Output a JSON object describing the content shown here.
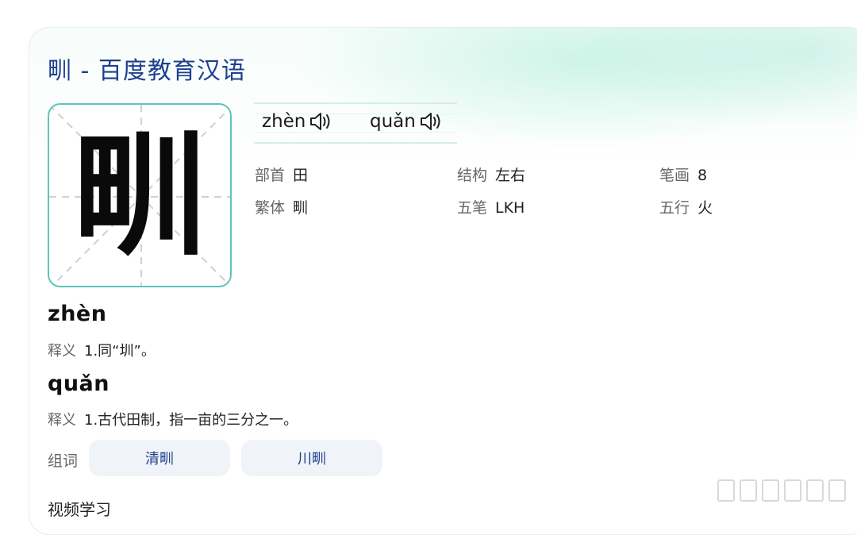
{
  "header": {
    "title": "甽 - 百度教育汉语"
  },
  "character": {
    "glyph": "甽"
  },
  "pronunciations": [
    {
      "pinyin": "zhèn",
      "icon": "speaker-icon"
    },
    {
      "pinyin": "quǎn",
      "icon": "speaker-icon"
    }
  ],
  "info": {
    "radical": {
      "label": "部首",
      "value": "田"
    },
    "structure": {
      "label": "结构",
      "value": "左右"
    },
    "strokes": {
      "label": "笔画",
      "value": "8"
    },
    "traditional": {
      "label": "繁体",
      "value": "甽"
    },
    "wubi": {
      "label": "五笔",
      "value": "LKH"
    },
    "element": {
      "label": "五行",
      "value": "火"
    }
  },
  "definitions": [
    {
      "pinyin": "zhèn",
      "label": "释义",
      "text": "1.同“圳”。"
    },
    {
      "pinyin": "quǎn",
      "label": "释义",
      "text": "1.古代田制，指一亩的三分之一。"
    }
  ],
  "words": {
    "label": "组词",
    "items": [
      "清甽",
      "川甽"
    ]
  },
  "video": {
    "title": "视频学习"
  },
  "colors": {
    "title": "#1d3f8e",
    "box_border": "#5cc6b6",
    "accent_bg": "#d4f1ea",
    "word_bg": "#f0f3f7"
  }
}
